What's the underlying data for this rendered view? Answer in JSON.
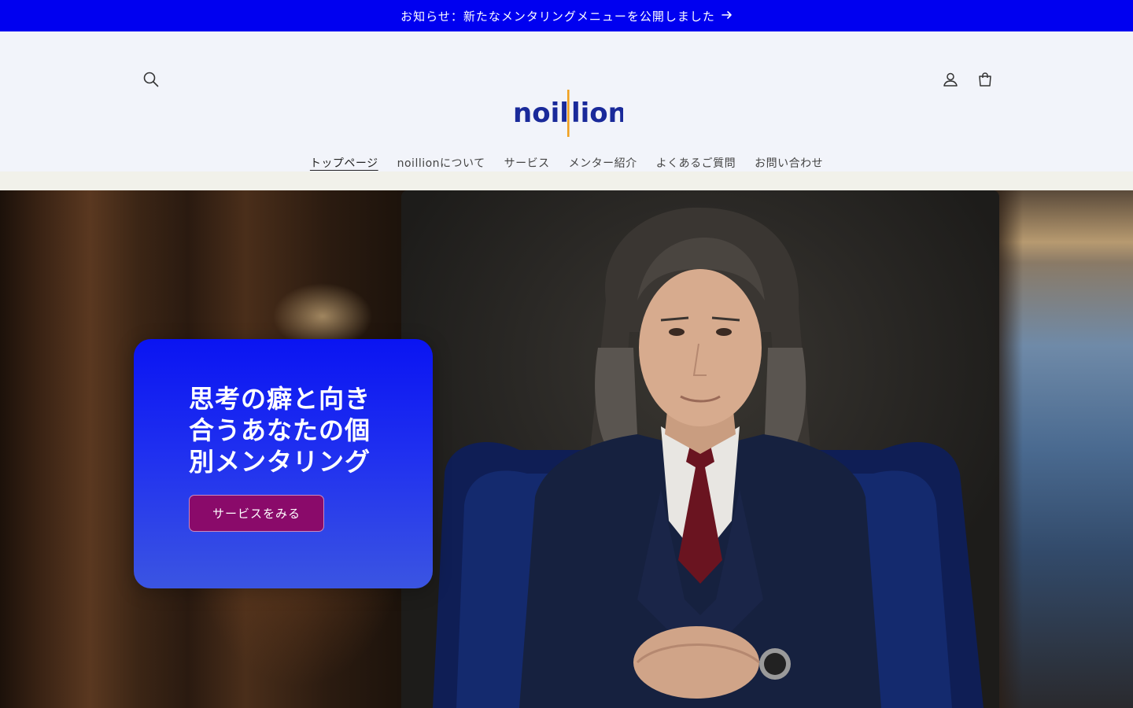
{
  "announcement": {
    "text": "お知らせ：新たなメンタリングメニューを公開しました",
    "arrow_icon": "arrow-right-icon"
  },
  "header": {
    "logo_text_left": "noil",
    "logo_text_right": "lion",
    "icons": [
      "search-icon",
      "account-icon",
      "cart-icon"
    ],
    "nav": [
      {
        "label": "トップページ",
        "active": true
      },
      {
        "label": "noillionについて"
      },
      {
        "label": "サービス"
      },
      {
        "label": "メンター紹介"
      },
      {
        "label": "よくあるご質問"
      },
      {
        "label": "お問い合わせ"
      }
    ]
  },
  "hero": {
    "title_bold": "思考の癖",
    "title_rest": "と向き合うあなたの個別メンタリング",
    "button_label": "サービスをみる"
  },
  "colors": {
    "announcement_bg": "#0000f0",
    "header_bg": "#f2f4fa",
    "logo_text": "#1a2a9a",
    "logo_accent": "#f0a020",
    "hero_card_top": "#0a14f2",
    "hero_card_bottom": "#3b55e2",
    "hero_button": "#8a0a6a"
  }
}
